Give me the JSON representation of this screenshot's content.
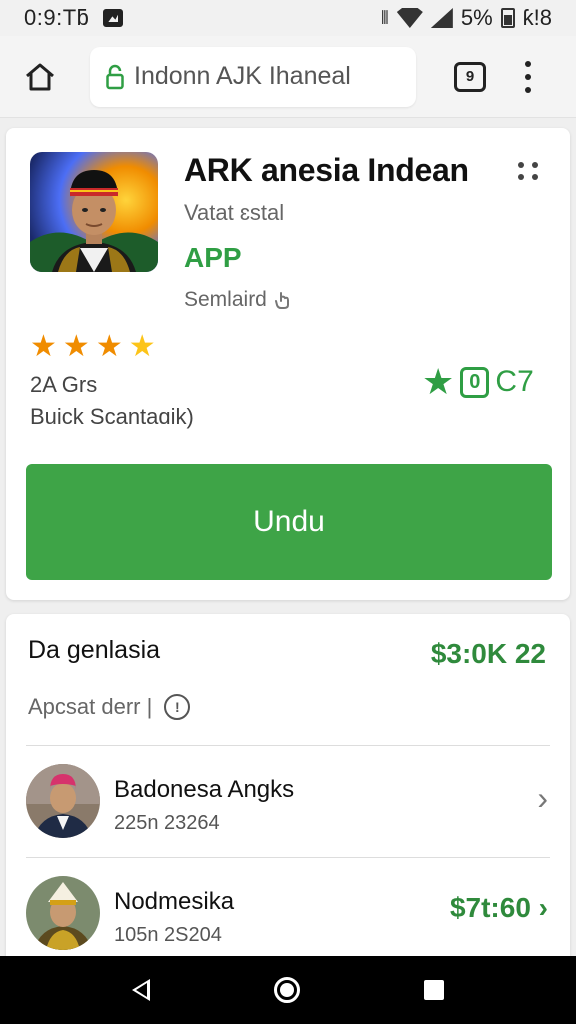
{
  "status_bar": {
    "time": "0:9:Tƃ",
    "battery_text": "5%",
    "clock_right": "ƙ!8"
  },
  "toolbar": {
    "url": "Indonn AJK Ihaneal",
    "tab_count": "9"
  },
  "app": {
    "title": "ARK anesia Indean",
    "developer": "Vatat ɛstal",
    "badge": "APP",
    "status": "Semlaird",
    "rating_stars": 3.5,
    "review_count": "2A Grs",
    "review_sub": "Buick Scantaɑik)",
    "rating_badge": "0",
    "rating_value": "C7",
    "install_label": "Undu",
    "accent_color": "#3ea447"
  },
  "details": {
    "title": "Da genlasia",
    "price": "$3:0K 22",
    "meta": "Apcsat derr |",
    "items": [
      {
        "name": "Badonesa Angks",
        "sub": "225n 23264",
        "price": ""
      },
      {
        "name": "Nodmesika",
        "sub": "105n 2S204",
        "price": "$7t:60"
      }
    ]
  }
}
